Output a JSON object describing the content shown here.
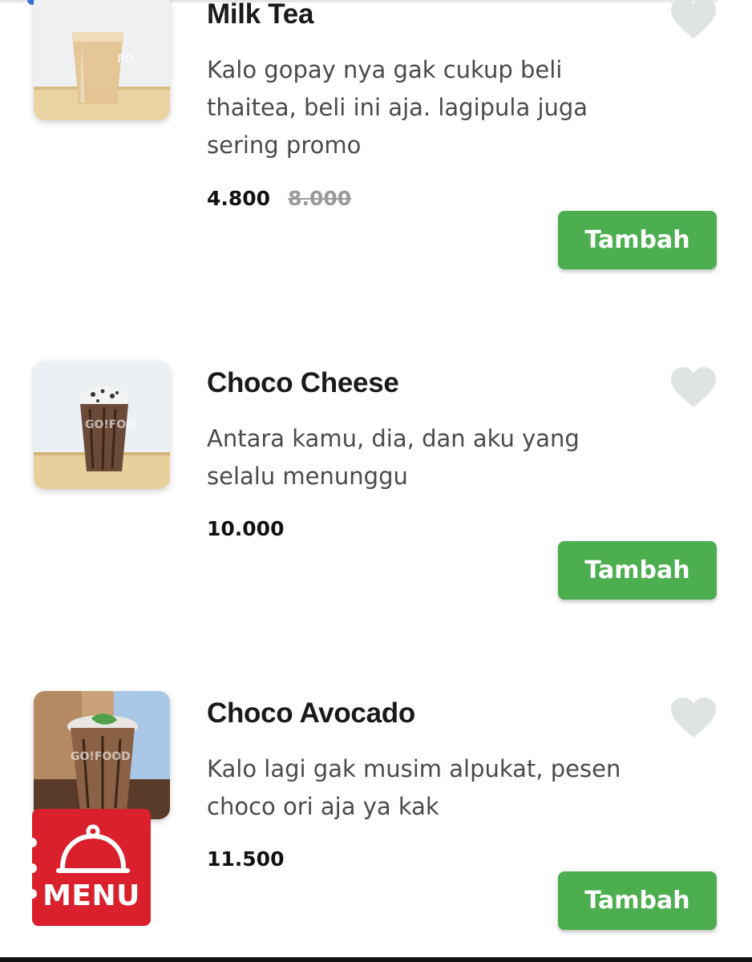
{
  "items": [
    {
      "name": "Milk Tea",
      "desc_lines": [
        "Kalo gopay nya gak cukup beli",
        "thaitea, beli ini aja. lagipula juga",
        "sering promo"
      ],
      "price": "4.800",
      "old_price": "8.000",
      "button": "Tambah",
      "image": "milk-tea-cup-icon"
    },
    {
      "name": "Choco Cheese",
      "desc_lines": [
        "Antara kamu, dia, dan aku yang",
        "selalu menunggu"
      ],
      "price": "10.000",
      "button": "Tambah",
      "image": "choco-cheese-cup-icon"
    },
    {
      "name": "Choco Avocado",
      "desc_lines": [
        "Kalo lagi gak musim alpukat, pesen",
        "choco ori aja ya kak"
      ],
      "price": "11.500",
      "button": "Tambah",
      "image": "choco-avocado-cup-icon"
    }
  ],
  "menu_badge": {
    "label": "MENU",
    "icon": "cloche-icon"
  },
  "colors": {
    "add_button": "#4cae4f",
    "menu_badge": "#d9202c",
    "heart": "#dfe3e3",
    "accent": "#3f6fd8"
  }
}
